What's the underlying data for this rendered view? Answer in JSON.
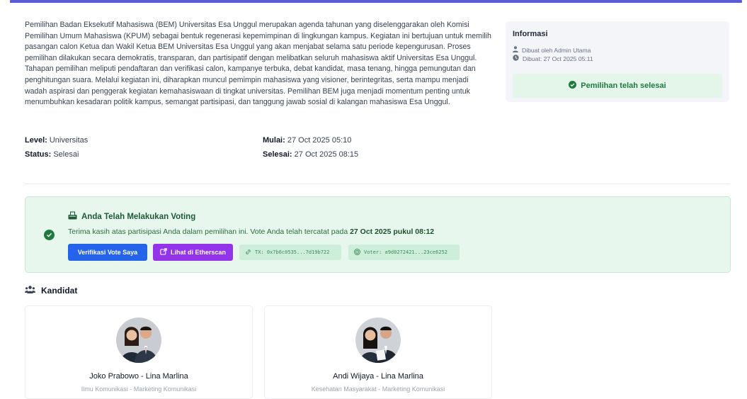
{
  "event": {
    "description": "Pemilihan Badan Eksekutif Mahasiswa (BEM) Universitas Esa Unggul merupakan agenda tahunan yang diselenggarakan oleh Komisi Pemilihan Umum Mahasiswa (KPUM) sebagai bentuk regenerasi kepemimpinan di lingkungan kampus. Kegiatan ini bertujuan untuk memilih pasangan calon Ketua dan Wakil Ketua BEM Universitas Esa Unggul yang akan menjabat selama satu periode kepengurusan. Proses pemilihan dilakukan secara demokratis, transparan, dan partisipatif dengan melibatkan seluruh mahasiswa aktif Universitas Esa Unggul. Tahapan pemilihan meliputi pendaftaran dan verifikasi calon, kampanye terbuka, debat kandidat, masa tenang, hingga pemungutan dan penghitungan suara. Melalui kegiatan ini, diharapkan muncul pemimpin mahasiswa yang visioner, berintegritas, serta mampu menjadi wadah aspirasi dan penggerak kegiatan kemahasiswaan di tingkat universitas. Pemilihan BEM juga menjadi momentum penting untuk menumbuhkan kesadaran politik kampus, semangat partisipasi, dan tanggung jawab sosial di kalangan mahasiswa Esa Unggul.",
    "level_label": "Level:",
    "level_value": "Universitas",
    "status_label": "Status:",
    "status_value": "Selesai",
    "start_label": "Mulai:",
    "start_value": "27 Oct 2025 05:10",
    "end_label": "Selesai:",
    "end_value": "27 Oct 2025 08:15"
  },
  "info": {
    "title": "Informasi",
    "created_by": "Dibuat oleh Admin Utama",
    "created_at": "Dibuat: 27 Oct 2025 05:11",
    "status": "Pemilihan telah selesai"
  },
  "vote": {
    "title": "Anda Telah Melakukan Voting",
    "message_prefix": "Terima kasih atas partisipasi Anda dalam pemilihan ini. Vote Anda telah tercatat pada",
    "message_time": "27 Oct 2025 pukul 08:12",
    "verify_button": "Verifikasi Vote Saya",
    "etherscan_button": "Lihat di Etherscan",
    "tx_chip": "TX: 0x7b6c0535...7d19b722",
    "voter_chip": "Voter: a9d0272421...23ce6252"
  },
  "candidates": {
    "title": "Kandidat",
    "items": [
      {
        "name": "Joko Prabowo - Lina Marlina",
        "subtitle": "Ilmu Komunikasi - Marketing Komunikasi"
      },
      {
        "name": "Andi Wijaya - Lina Marlina",
        "subtitle": "Kesehatan Masyarakat - Marketing Komunikasi"
      }
    ]
  },
  "colors": {
    "accent": "#5b5bd6",
    "success": "#1f7a3d",
    "primary_button": "#2563eb",
    "etherscan_button": "#9333ea"
  }
}
